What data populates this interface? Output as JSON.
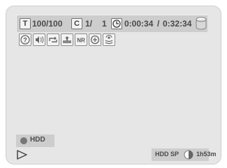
{
  "status": {
    "title_badge": "T",
    "title_value": "100/100",
    "chapter_badge": "C",
    "chapter_value": "1/",
    "chapter_total": "1",
    "elapsed": "0:00:34",
    "separator": "/",
    "total": "0:32:34"
  },
  "icons": [
    "help-icon",
    "audio-icon",
    "repeat-icon",
    "marker-icon",
    "noise-reduction-icon",
    "zoom-icon",
    "surround-icon"
  ],
  "icon_labels": {
    "noise_reduction": "NR"
  },
  "media": {
    "label": "HDD"
  },
  "playback": {
    "state": "play"
  },
  "recording": {
    "mode": "HDD SP",
    "remaining": "1h53m",
    "remaining_fraction": 0.5
  },
  "colors": {
    "background": "#e6e6e6",
    "bar": "#cdcdcd",
    "text": "#4a4a4a"
  }
}
